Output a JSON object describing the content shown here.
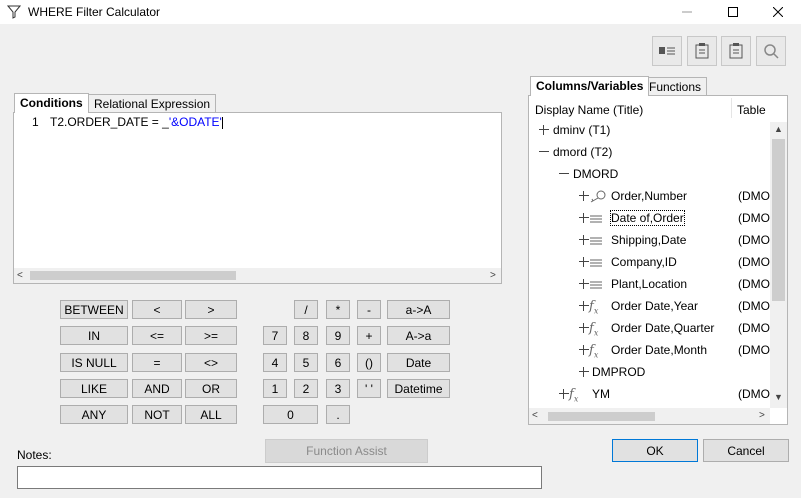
{
  "window": {
    "title": "WHERE Filter Calculator",
    "minimize_icon": "minimize-icon",
    "maximize_icon": "maximize-icon",
    "close_icon": "close-icon"
  },
  "toolbar": {
    "icons": [
      "list-icon",
      "clipboard-icon",
      "clipboard-icon",
      "search-icon"
    ]
  },
  "left_tabs": [
    "Conditions",
    "Relational Expression"
  ],
  "editor": {
    "line_number": "1",
    "code_prefix": "T2.ORDER_DATE = _",
    "code_literal": "'&ODATE'",
    "literal_color": "#0000ff"
  },
  "keypad": {
    "ops": [
      [
        "BETWEEN",
        "<",
        ">"
      ],
      [
        "IN",
        "<=",
        ">="
      ],
      [
        "IS NULL",
        "=",
        "<>"
      ],
      [
        "LIKE",
        "AND",
        "OR"
      ],
      [
        "ANY",
        "NOT",
        "ALL"
      ]
    ],
    "nums": [
      [
        "/",
        "*",
        "-"
      ],
      [
        "7",
        "8",
        "9",
        "+"
      ],
      [
        "4",
        "5",
        "6",
        "()"
      ],
      [
        "1",
        "2",
        "3",
        "' '"
      ],
      [
        "0",
        "."
      ]
    ],
    "funcs": [
      "a->A",
      "A->a",
      "Date",
      "Datetime"
    ]
  },
  "function_assist": "Function Assist",
  "notes_label": "Notes:",
  "notes_value": "",
  "right_tabs": [
    "Columns/Variables",
    "Functions"
  ],
  "tree": {
    "headers": [
      "Display Name (Title)",
      "Table"
    ],
    "rows": [
      {
        "label": "dminv (T1)",
        "table": "",
        "expander": "plus",
        "icon": ""
      },
      {
        "label": "dmord (T2)",
        "table": "",
        "expander": "minus",
        "icon": ""
      },
      {
        "label": "DMORD",
        "table": "",
        "expander": "minus",
        "icon": ""
      },
      {
        "label": "Order,Number",
        "table": "(DMO",
        "expander": "plus",
        "icon": "key-icon"
      },
      {
        "label": "Date of,Order",
        "table": "(DMO",
        "expander": "plus",
        "icon": "field-icon"
      },
      {
        "label": "Shipping,Date",
        "table": "(DMO",
        "expander": "plus",
        "icon": "field-icon"
      },
      {
        "label": "Company,ID",
        "table": "(DMO",
        "expander": "plus",
        "icon": "field-icon"
      },
      {
        "label": "Plant,Location",
        "table": "(DMO",
        "expander": "plus",
        "icon": "field-icon"
      },
      {
        "label": "Order Date,Year",
        "table": "(DMO",
        "expander": "plus",
        "icon": "fx-icon"
      },
      {
        "label": "Order Date,Quarter",
        "table": "(DMO",
        "expander": "plus",
        "icon": "fx-icon"
      },
      {
        "label": "Order Date,Month",
        "table": "(DMO",
        "expander": "plus",
        "icon": "fx-icon"
      },
      {
        "label": "DMPROD",
        "table": "",
        "expander": "plus",
        "icon": ""
      },
      {
        "label": "YM",
        "table": "(DMO",
        "expander": "plus",
        "icon": "fx-icon"
      }
    ]
  },
  "buttons": {
    "ok": "OK",
    "cancel": "Cancel"
  }
}
